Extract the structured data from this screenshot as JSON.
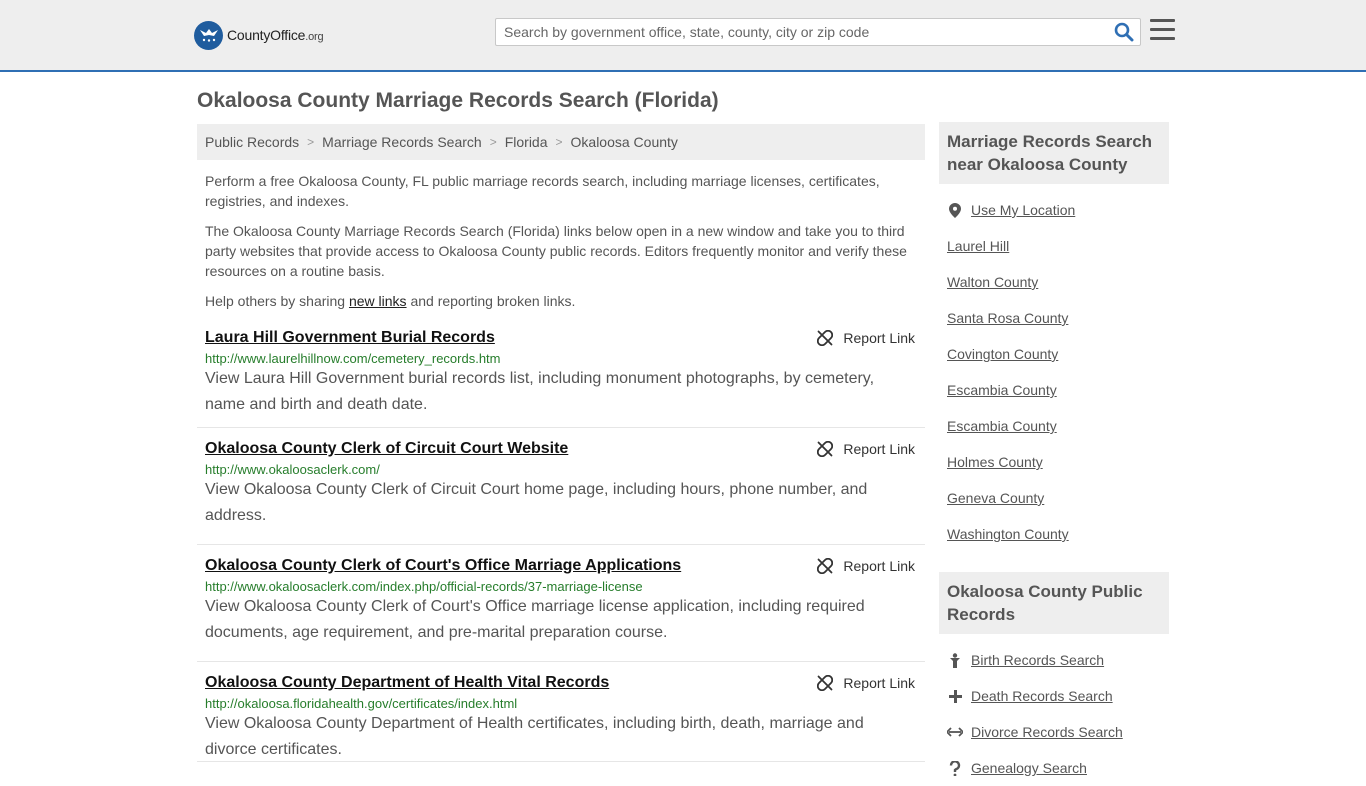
{
  "header": {
    "logo_main": "CountyOffice",
    "logo_suffix": ".org",
    "search_placeholder": "Search by government office, state, county, city or zip code"
  },
  "page": {
    "title": "Okaloosa County Marriage Records Search (Florida)"
  },
  "breadcrumb": [
    "Public Records",
    "Marriage Records Search",
    "Florida",
    "Okaloosa County"
  ],
  "intro": {
    "p1": "Perform a free Okaloosa County, FL public marriage records search, including marriage licenses, certificates, registries, and indexes.",
    "p2": "The Okaloosa County Marriage Records Search (Florida) links below open in a new window and take you to third party websites that provide access to Okaloosa County public records. Editors frequently monitor and verify these resources on a routine basis.",
    "p3_before": "Help others by sharing ",
    "p3_link": "new links",
    "p3_after": " and reporting broken links."
  },
  "report_label": "Report Link",
  "results": [
    {
      "title": "Laura Hill Government Burial Records",
      "url": "http://www.laurelhillnow.com/cemetery_records.htm",
      "desc": "View Laura Hill Government burial records list, including monument photographs, by cemetery, name and birth and death date."
    },
    {
      "title": "Okaloosa County Clerk of Circuit Court Website",
      "url": "http://www.okaloosaclerk.com/",
      "desc": "View Okaloosa County Clerk of Circuit Court home page, including hours, phone number, and address."
    },
    {
      "title": "Okaloosa County Clerk of Court's Office Marriage Applications",
      "url": "http://www.okaloosaclerk.com/index.php/official-records/37-marriage-license",
      "desc": "View Okaloosa County Clerk of Court's Office marriage license application, including required documents, age requirement, and pre-marital preparation course."
    },
    {
      "title": "Okaloosa County Department of Health Vital Records",
      "url": "http://okaloosa.floridahealth.gov/certificates/index.html",
      "desc": "View Okaloosa County Department of Health certificates, including birth, death, marriage and divorce certificates."
    }
  ],
  "sidebar": {
    "nearby_title": "Marriage Records Search near Okaloosa County",
    "use_location": "Use My Location",
    "nearby": [
      "Laurel Hill",
      "Walton County",
      "Santa Rosa County",
      "Covington County",
      "Escambia County",
      "Escambia County",
      "Holmes County",
      "Geneva County",
      "Washington County"
    ],
    "public_title": "Okaloosa County Public Records",
    "public_items": [
      {
        "label": "Birth Records Search",
        "icon": "baby-icon"
      },
      {
        "label": "Death Records Search",
        "icon": "cross-icon"
      },
      {
        "label": "Divorce Records Search",
        "icon": "arrows-icon"
      },
      {
        "label": "Genealogy Search",
        "icon": "question-icon"
      }
    ]
  },
  "colors": {
    "header_bg": "#eeeeee",
    "header_border": "#2f6fb4",
    "url_green": "#267d2b",
    "logo_blue": "#1f5c9e"
  }
}
